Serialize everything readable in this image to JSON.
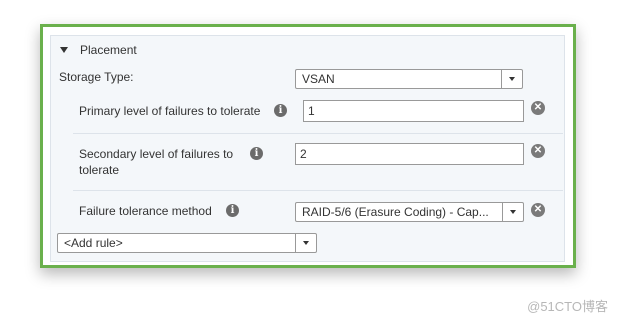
{
  "section": {
    "title": "Placement"
  },
  "storage_type": {
    "label": "Storage Type:",
    "value": "VSAN"
  },
  "rules": [
    {
      "label": "Primary level of failures to tolerate",
      "value": "1"
    },
    {
      "label_line1": "Secondary level of failures to",
      "label_line2": "tolerate",
      "value": "2"
    },
    {
      "label": "Failure tolerance method",
      "value": "RAID-5/6 (Erasure Coding) - Cap..."
    }
  ],
  "add_rule": {
    "value": "<Add rule>"
  },
  "watermark": "@51CTO博客",
  "colors": {
    "frame_border": "#6ab04c",
    "panel_bg": "#f4f7fa"
  }
}
